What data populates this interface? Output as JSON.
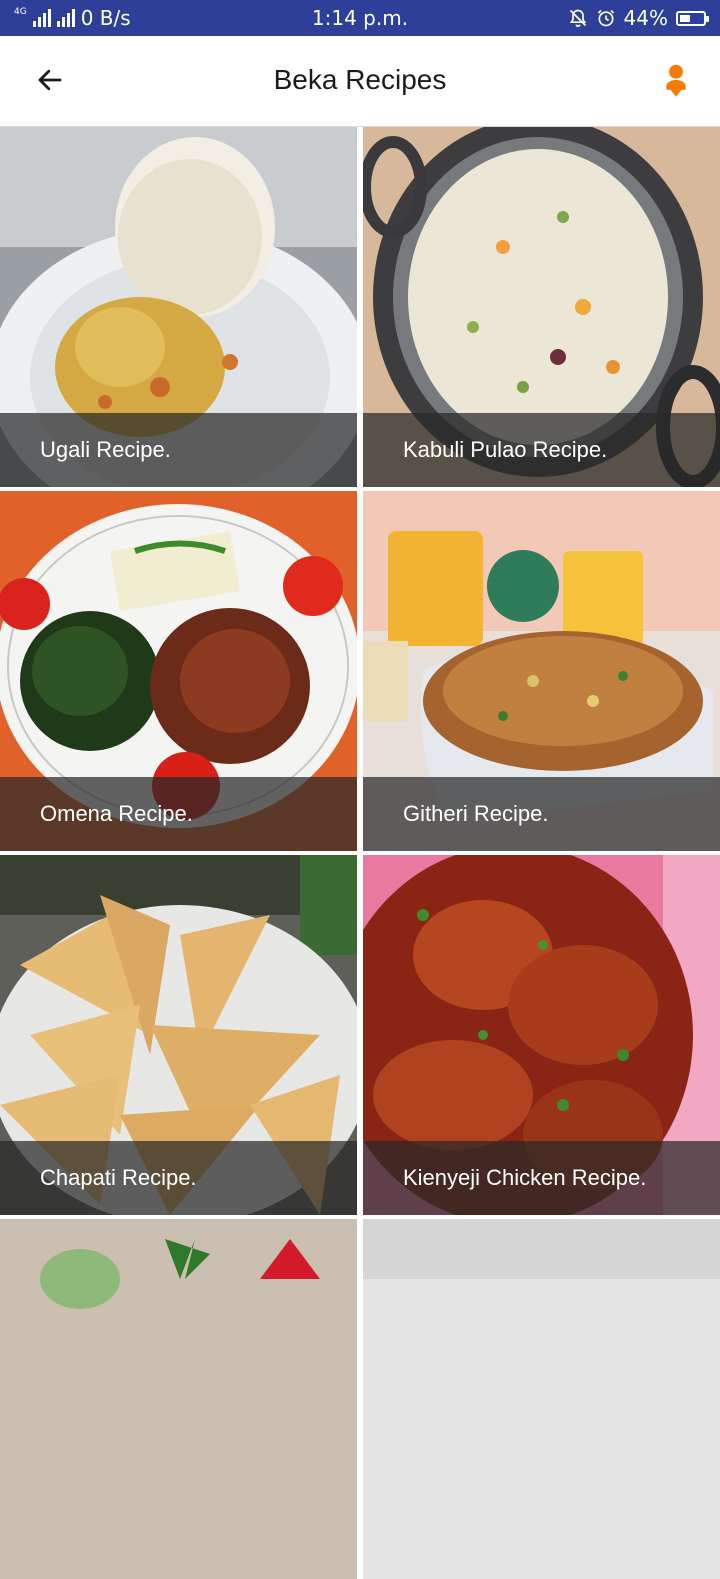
{
  "status_bar": {
    "network_type": "4G",
    "data_speed": "0 B/s",
    "time": "1:14 p.m.",
    "battery_percent": "44%",
    "battery_level": 0.44
  },
  "app_bar": {
    "title": "Beka Recipes",
    "back_icon": "arrow-left-icon",
    "profile_icon": "person-pin-icon",
    "accent_color": "#f57c00"
  },
  "recipes": [
    {
      "label": "Ugali Recipe."
    },
    {
      "label": "Kabuli Pulao Recipe."
    },
    {
      "label": "Omena Recipe."
    },
    {
      "label": "Githeri Recipe."
    },
    {
      "label": "Chapati Recipe."
    },
    {
      "label": "Kienyeji Chicken Recipe."
    }
  ]
}
